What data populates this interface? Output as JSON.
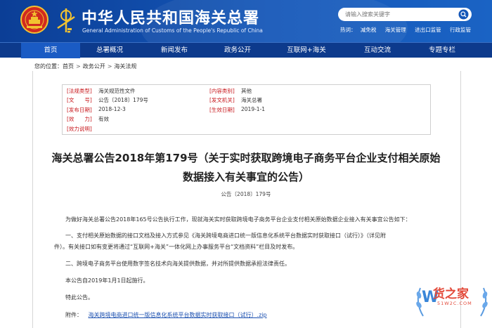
{
  "header": {
    "title": "中华人民共和国海关总署",
    "subtitle": "General Administration of Customs of the People's Republic of China",
    "search_placeholder": "请输入搜索关键字",
    "hot_label": "热词：",
    "hot_words": [
      "减免税",
      "海关管理",
      "进出口监管",
      "行政监管"
    ]
  },
  "nav": {
    "items": [
      "首页",
      "总署概况",
      "新闻发布",
      "政务公开",
      "互联网+海关",
      "互动交流",
      "专题专栏"
    ]
  },
  "breadcrumb": {
    "prefix": "您的位置：",
    "items": [
      "首页",
      "政务公开",
      "海关法规"
    ]
  },
  "meta": {
    "law_type_label": "[法规类型]",
    "law_type": "海关规范性文件",
    "content_type_label": "[内容类别]",
    "content_type": "其他",
    "doc_no_label": "[文　　号]",
    "doc_no": "公告〔2018〕179号",
    "issuer_label": "[发文机关]",
    "issuer": "海关总署",
    "publish_date_label": "[发布日期]",
    "publish_date": "2018-12-3",
    "effective_date_label": "[生效日期]",
    "effective_date": "2019-1-1",
    "validity_label": "[效　　力]",
    "validity": "有效",
    "validity_note_label": "[效力说明]",
    "validity_note": ""
  },
  "article": {
    "title_line1": "海关总署公告2018年第179号（关于实时获取跨境电子商务平台企业支付相关原始",
    "title_line2": "数据接入有关事宜的公告）",
    "number": "公告〔2018〕179号",
    "p1": "为做好海关总署公告2018年165号公告执行工作，现就海关实时获取跨境电子商务平台企业支付相关原始数据企业接入有关事宜公告如下：",
    "p2a": "一、支付相关原始数据的接口文档及接入方式参见《海关跨境电商进口统一版信息化系统平台数据实时获取接口（试行）》（详见附",
    "p2b": "件）。有关接口如有变更将通过“互联网+海关”一体化网上办事服务平台“文档资料”栏目及时发布。",
    "p3": "二、跨境电子商务平台使用数字签名技术向海关提供数据，并对所提供数据承担法律责任。",
    "p4": "本公告自2019年1月1日起施行。",
    "p5": "特此公告。",
    "attach_label": "附件：",
    "attach_link": "海关跨境电商进口统一版信息化系统平台数据实时获取接口（试行）.zip"
  },
  "watermark": {
    "brand": "货之家",
    "url": "51W2C.COM"
  },
  "colors": {
    "header_blue": "#1557b8",
    "nav_blue": "#0d3a8c",
    "label_red": "#c8191e",
    "link_blue": "#1a4fb0",
    "watermark_red": "#e34a3a"
  }
}
